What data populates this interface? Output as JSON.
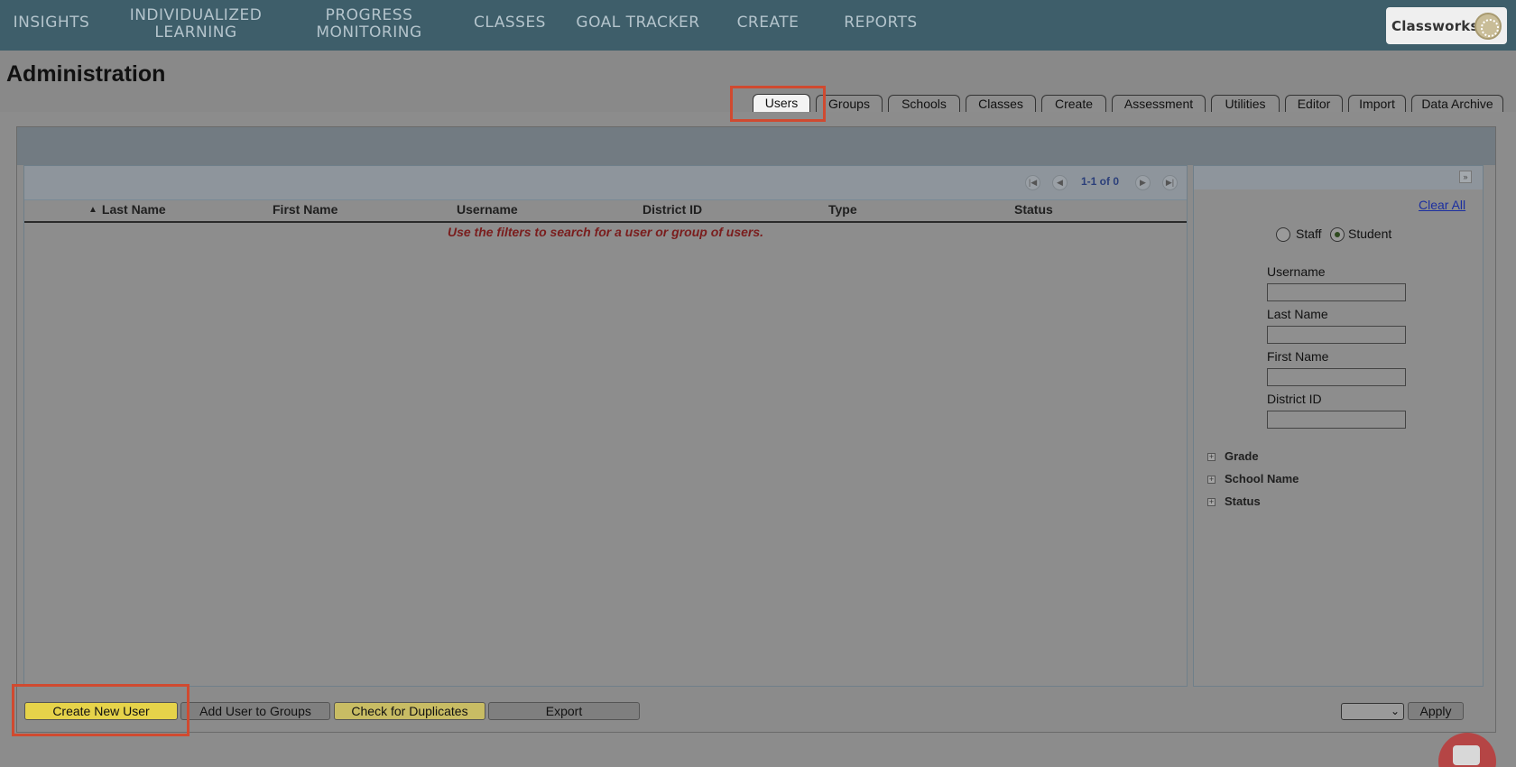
{
  "nav": {
    "items": [
      {
        "line1": "INSIGHTS",
        "line2": ""
      },
      {
        "line1": "INDIVIDUALIZED",
        "line2": "LEARNING"
      },
      {
        "line1": "PROGRESS",
        "line2": "MONITORING"
      },
      {
        "line1": "CLASSES",
        "line2": ""
      },
      {
        "line1": "GOAL TRACKER",
        "line2": ""
      },
      {
        "line1": "CREATE",
        "line2": ""
      },
      {
        "line1": "REPORTS",
        "line2": ""
      }
    ],
    "brand": "Classworks",
    "brand_icon": "classworks-logo-icon"
  },
  "page": {
    "title": "Administration"
  },
  "tabs": [
    {
      "label": "Users",
      "active": true
    },
    {
      "label": "Groups"
    },
    {
      "label": "Schools"
    },
    {
      "label": "Classes"
    },
    {
      "label": "Create"
    },
    {
      "label": "Assessment"
    },
    {
      "label": "Utilities"
    },
    {
      "label": "Editor"
    },
    {
      "label": "Import"
    },
    {
      "label": "Data Archive"
    }
  ],
  "grid": {
    "pager_text": "1-1 of 0",
    "columns": [
      "Last Name",
      "First Name",
      "Username",
      "District ID",
      "Type",
      "Status"
    ],
    "sort_indicator": "▲",
    "empty_message": "Use the filters to search for a user or group of users."
  },
  "filters": {
    "clear_all": "Clear All",
    "user_types": [
      {
        "label": "Staff",
        "checked": false
      },
      {
        "label": "Student",
        "checked": true
      }
    ],
    "fields": [
      {
        "label": "Username",
        "value": ""
      },
      {
        "label": "Last Name",
        "value": ""
      },
      {
        "label": "First Name",
        "value": ""
      },
      {
        "label": "District ID",
        "value": ""
      }
    ],
    "expanders": [
      "Grade",
      "School Name",
      "Status"
    ]
  },
  "actions": {
    "create_new_user": "Create New User",
    "add_user_to_groups": "Add User to Groups",
    "check_for_duplicates": "Check for Duplicates",
    "export": "Export",
    "bulk_action_value": "",
    "apply": "Apply"
  },
  "colors": {
    "nav_bg": "#3e5e6a",
    "highlight": "#d04a30",
    "primary_button": "#e6d34a"
  }
}
